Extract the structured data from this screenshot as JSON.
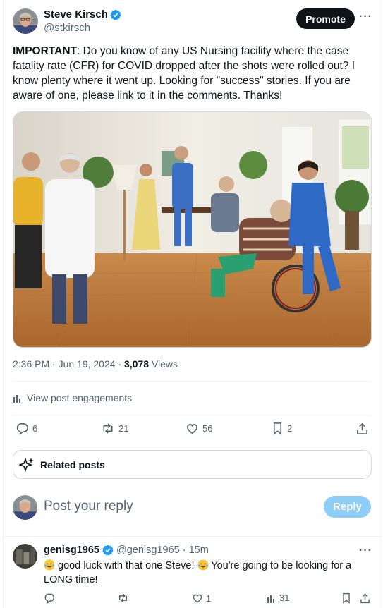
{
  "author": {
    "name": "Steve Kirsch",
    "handle": "@stkirsch"
  },
  "header": {
    "promote_label": "Promote",
    "more_label": "···"
  },
  "post": {
    "text_bold": "IMPORTANT",
    "text_rest": ": Do you know of any US Nursing facility where the case fatality rate (CFR) for COVID dropped after the shots were rolled out? I know plenty where it went up. Looking for \"success\" stories. If you are aware of one, please link to it in the comments. Thanks!",
    "timestamp": "2:36 PM · Jun 19, 2024 · ",
    "views_count": "3,078",
    "views_label": " Views",
    "engagements_label": "View post engagements"
  },
  "actions": {
    "replies": "6",
    "reposts": "21",
    "likes": "56",
    "bookmarks": "2"
  },
  "related": {
    "label": "Related posts"
  },
  "reply_box": {
    "placeholder": "Post your reply",
    "button_label": "Reply"
  },
  "comment": {
    "name": "genisg1965",
    "handle": "@genisg1965",
    "time": "· 15m",
    "text_a": " good luck with that one Steve! ",
    "text_b": " You're going to be looking for a LONG time!",
    "likes": "1",
    "views": "31"
  },
  "colors": {
    "accent": "#1d9bf0",
    "muted": "#536471",
    "reply_button": "#8ecdf8"
  }
}
